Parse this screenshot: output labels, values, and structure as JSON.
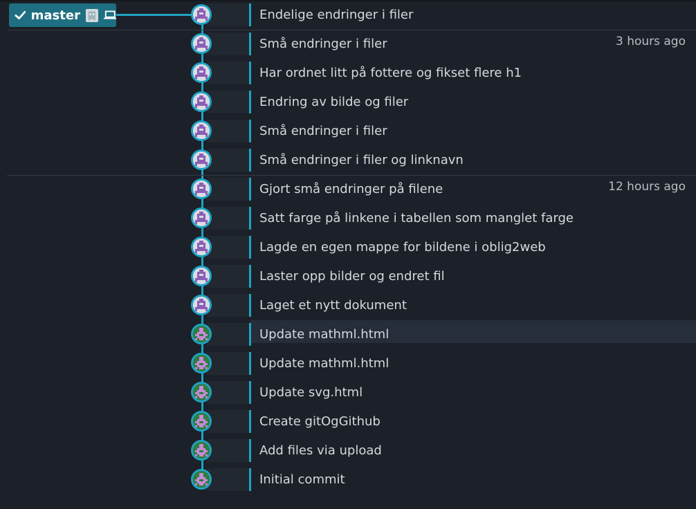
{
  "branch": {
    "name": "master",
    "check_icon": "check-icon",
    "avatar_icon": "ghost-avatar-icon",
    "computer_icon": "laptop-icon"
  },
  "colors": {
    "accent": "#1fa3c4",
    "branch_bg": "#1f6f82",
    "background": "#1c2028",
    "text": "#d6d9de",
    "avatar_purple": "#8b5fb5",
    "avatar_green": "#2f7d40"
  },
  "commits": [
    {
      "message": "Endelige endringer i filer",
      "time": "",
      "avatar": "purple"
    },
    {
      "message": "Små endringer i filer",
      "time": "3 hours ago",
      "avatar": "purple"
    },
    {
      "message": "Har ordnet litt på fottere og fikset flere h1",
      "time": "",
      "avatar": "purple"
    },
    {
      "message": "Endring av bilde og filer",
      "time": "",
      "avatar": "purple"
    },
    {
      "message": "Små endringer i filer",
      "time": "",
      "avatar": "purple"
    },
    {
      "message": "Små endringer i filer og linknavn",
      "time": "",
      "avatar": "purple"
    },
    {
      "message": "Gjort små endringer på filene",
      "time": "12 hours ago",
      "avatar": "purple"
    },
    {
      "message": "Satt farge på linkene i tabellen som manglet farge",
      "time": "",
      "avatar": "purple"
    },
    {
      "message": "Lagde en egen mappe for bildene i oblig2web",
      "time": "",
      "avatar": "purple"
    },
    {
      "message": "Laster opp bilder og endret fil",
      "time": "",
      "avatar": "purple"
    },
    {
      "message": "Laget et nytt dokument",
      "time": "",
      "avatar": "purple"
    },
    {
      "message": "Update mathml.html",
      "time": "",
      "avatar": "green",
      "selected": true
    },
    {
      "message": "Update mathml.html",
      "time": "",
      "avatar": "green"
    },
    {
      "message": "Update svg.html",
      "time": "",
      "avatar": "green"
    },
    {
      "message": "Create gitOgGithub",
      "time": "",
      "avatar": "green"
    },
    {
      "message": "Add files via upload",
      "time": "",
      "avatar": "green"
    },
    {
      "message": "Initial commit",
      "time": "",
      "avatar": "green"
    }
  ]
}
